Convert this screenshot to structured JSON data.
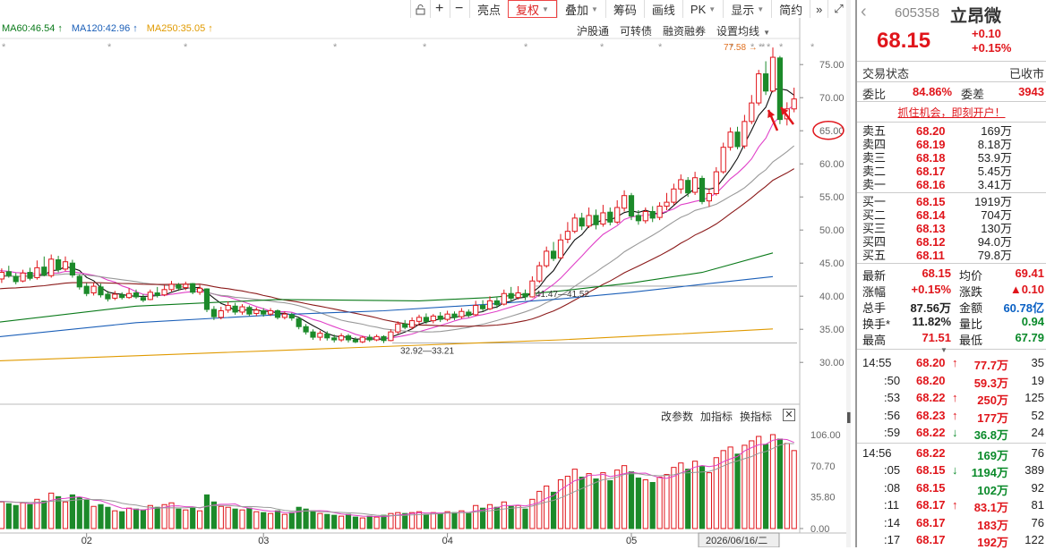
{
  "toolbar": {
    "icons": [
      "lock-icon",
      "plus-icon",
      "minus-icon"
    ],
    "buttons": [
      {
        "label": "亮点",
        "caret": false,
        "active": false
      },
      {
        "label": "复权",
        "caret": true,
        "active": true
      },
      {
        "label": "叠加",
        "caret": true,
        "active": false
      },
      {
        "label": "筹码",
        "caret": false,
        "active": false
      },
      {
        "label": "画线",
        "caret": false,
        "active": false
      },
      {
        "label": "PK",
        "caret": true,
        "active": false
      },
      {
        "label": "显示",
        "caret": true,
        "active": false
      },
      {
        "label": "简约",
        "caret": false,
        "active": false
      }
    ],
    "more_icon": "»",
    "fullscreen_icon": "⤢"
  },
  "ma_legend": [
    {
      "text": "MA60:46.54",
      "arrow": "↑",
      "color": "#0a7a1a"
    },
    {
      "text": "MA120:42.96",
      "arrow": "↑",
      "color": "#1b5fb8"
    },
    {
      "text": "MA250:35.05",
      "arrow": "↑",
      "color": "#e09a00"
    }
  ],
  "top_links": [
    "沪股通",
    "可转债",
    "融资融券",
    "设置均线"
  ],
  "annotations": {
    "high": "77.58 →",
    "range1": "41.47—41.52",
    "range2": "32.92—33.21",
    "circled_price": "65.00",
    "date_cursor": "2026/06/16/二"
  },
  "price_axis": [
    "75.00",
    "70.00",
    "65.00",
    "60.00",
    "55.00",
    "50.00",
    "45.00",
    "40.00",
    "35.00",
    "30.00"
  ],
  "vol_axis": [
    "106.00",
    "70.70",
    "35.80",
    "0.00"
  ],
  "x_axis": [
    "02",
    "03",
    "04",
    "05"
  ],
  "lower_links": [
    "改参数",
    "加指标",
    "换指标"
  ],
  "close_icon": "✕",
  "chart_data": {
    "type": "candlestick",
    "ylim": [
      28,
      78
    ],
    "ma_names": [
      "MA5",
      "MA10",
      "MA20",
      "MA30",
      "MA60",
      "MA120",
      "MA250"
    ],
    "candles": [
      {
        "o": 43.5,
        "c": 42.8,
        "h": 44.1,
        "l": 42.2,
        "v": 34
      },
      {
        "o": 42.6,
        "c": 43.6,
        "h": 44.2,
        "l": 42.0,
        "v": 30
      },
      {
        "o": 43.7,
        "c": 43.1,
        "h": 44.6,
        "l": 42.8,
        "v": 28
      },
      {
        "o": 43.0,
        "c": 42.2,
        "h": 43.5,
        "l": 41.8,
        "v": 26
      },
      {
        "o": 42.3,
        "c": 43.5,
        "h": 44.0,
        "l": 42.1,
        "v": 29
      },
      {
        "o": 43.6,
        "c": 42.7,
        "h": 44.3,
        "l": 42.4,
        "v": 27
      },
      {
        "o": 42.8,
        "c": 44.3,
        "h": 45.4,
        "l": 42.5,
        "v": 33
      },
      {
        "o": 44.4,
        "c": 43.2,
        "h": 46.0,
        "l": 43.0,
        "v": 31
      },
      {
        "o": 43.1,
        "c": 45.6,
        "h": 46.3,
        "l": 42.8,
        "v": 40
      },
      {
        "o": 45.5,
        "c": 44.0,
        "h": 46.1,
        "l": 43.6,
        "v": 36
      },
      {
        "o": 44.1,
        "c": 45.2,
        "h": 46.0,
        "l": 43.8,
        "v": 30
      },
      {
        "o": 45.0,
        "c": 43.2,
        "h": 45.5,
        "l": 42.8,
        "v": 38
      },
      {
        "o": 43.0,
        "c": 41.4,
        "h": 43.3,
        "l": 41.0,
        "v": 35
      },
      {
        "o": 41.5,
        "c": 40.4,
        "h": 42.0,
        "l": 40.0,
        "v": 32
      },
      {
        "o": 40.5,
        "c": 41.5,
        "h": 42.0,
        "l": 40.1,
        "v": 25
      },
      {
        "o": 41.4,
        "c": 40.2,
        "h": 41.9,
        "l": 39.8,
        "v": 27
      },
      {
        "o": 40.3,
        "c": 39.6,
        "h": 40.8,
        "l": 39.2,
        "v": 24
      },
      {
        "o": 39.7,
        "c": 40.3,
        "h": 40.8,
        "l": 39.4,
        "v": 20
      },
      {
        "o": 40.2,
        "c": 39.8,
        "h": 40.6,
        "l": 39.5,
        "v": 19
      },
      {
        "o": 39.8,
        "c": 40.4,
        "h": 41.2,
        "l": 39.6,
        "v": 23
      },
      {
        "o": 40.5,
        "c": 39.9,
        "h": 41.0,
        "l": 39.6,
        "v": 22
      },
      {
        "o": 39.8,
        "c": 39.4,
        "h": 40.3,
        "l": 39.1,
        "v": 21
      },
      {
        "o": 39.5,
        "c": 40.6,
        "h": 41.0,
        "l": 39.4,
        "v": 26
      },
      {
        "o": 40.5,
        "c": 40.1,
        "h": 41.4,
        "l": 39.8,
        "v": 24
      },
      {
        "o": 40.2,
        "c": 41.0,
        "h": 41.7,
        "l": 40.0,
        "v": 27
      },
      {
        "o": 41.0,
        "c": 41.8,
        "h": 42.3,
        "l": 40.7,
        "v": 29
      },
      {
        "o": 41.7,
        "c": 41.2,
        "h": 42.0,
        "l": 40.8,
        "v": 22
      },
      {
        "o": 41.3,
        "c": 41.8,
        "h": 42.2,
        "l": 40.9,
        "v": 21
      },
      {
        "o": 41.9,
        "c": 40.6,
        "h": 42.0,
        "l": 40.3,
        "v": 24
      },
      {
        "o": 40.6,
        "c": 41.2,
        "h": 41.7,
        "l": 40.2,
        "v": 20
      },
      {
        "o": 41.1,
        "c": 38.0,
        "h": 41.2,
        "l": 37.6,
        "v": 38
      },
      {
        "o": 38.0,
        "c": 36.9,
        "h": 38.5,
        "l": 36.4,
        "v": 30
      },
      {
        "o": 36.8,
        "c": 37.8,
        "h": 38.4,
        "l": 36.5,
        "v": 25
      },
      {
        "o": 37.9,
        "c": 38.6,
        "h": 39.2,
        "l": 37.5,
        "v": 24
      },
      {
        "o": 38.5,
        "c": 37.6,
        "h": 39.0,
        "l": 37.2,
        "v": 22
      },
      {
        "o": 37.6,
        "c": 38.4,
        "h": 38.8,
        "l": 37.2,
        "v": 21
      },
      {
        "o": 38.3,
        "c": 37.3,
        "h": 38.6,
        "l": 37.0,
        "v": 23
      },
      {
        "o": 37.4,
        "c": 37.9,
        "h": 38.3,
        "l": 37.0,
        "v": 19
      },
      {
        "o": 37.8,
        "c": 37.3,
        "h": 38.2,
        "l": 36.9,
        "v": 18
      },
      {
        "o": 37.3,
        "c": 37.8,
        "h": 38.2,
        "l": 37.0,
        "v": 17
      },
      {
        "o": 37.8,
        "c": 36.8,
        "h": 38.0,
        "l": 36.5,
        "v": 20
      },
      {
        "o": 36.8,
        "c": 37.3,
        "h": 37.7,
        "l": 36.5,
        "v": 16
      },
      {
        "o": 37.2,
        "c": 36.7,
        "h": 37.5,
        "l": 36.3,
        "v": 18
      },
      {
        "o": 36.6,
        "c": 35.4,
        "h": 36.8,
        "l": 35.0,
        "v": 24
      },
      {
        "o": 35.4,
        "c": 34.6,
        "h": 35.8,
        "l": 34.2,
        "v": 22
      },
      {
        "o": 34.6,
        "c": 33.8,
        "h": 35.0,
        "l": 33.4,
        "v": 20
      },
      {
        "o": 33.8,
        "c": 34.4,
        "h": 34.8,
        "l": 33.3,
        "v": 17
      },
      {
        "o": 34.3,
        "c": 33.7,
        "h": 34.7,
        "l": 33.3,
        "v": 16
      },
      {
        "o": 33.7,
        "c": 33.4,
        "h": 34.2,
        "l": 33.0,
        "v": 15
      },
      {
        "o": 33.4,
        "c": 34.0,
        "h": 34.4,
        "l": 33.1,
        "v": 14
      },
      {
        "o": 34.0,
        "c": 33.4,
        "h": 34.3,
        "l": 33.0,
        "v": 16
      },
      {
        "o": 33.4,
        "c": 33.1,
        "h": 33.8,
        "l": 32.9,
        "v": 13
      },
      {
        "o": 33.1,
        "c": 33.8,
        "h": 34.0,
        "l": 32.9,
        "v": 12
      },
      {
        "o": 33.8,
        "c": 33.4,
        "h": 34.2,
        "l": 33.1,
        "v": 14
      },
      {
        "o": 33.4,
        "c": 33.9,
        "h": 34.2,
        "l": 33.2,
        "v": 13
      },
      {
        "o": 33.9,
        "c": 33.3,
        "h": 34.1,
        "l": 32.92,
        "v": 15
      },
      {
        "o": 33.3,
        "c": 34.6,
        "h": 35.0,
        "l": 33.2,
        "v": 17
      },
      {
        "o": 34.6,
        "c": 35.8,
        "h": 36.2,
        "l": 34.3,
        "v": 18
      },
      {
        "o": 35.8,
        "c": 35.3,
        "h": 36.4,
        "l": 35.0,
        "v": 17
      },
      {
        "o": 35.3,
        "c": 36.3,
        "h": 36.8,
        "l": 35.0,
        "v": 18
      },
      {
        "o": 36.2,
        "c": 36.8,
        "h": 37.2,
        "l": 35.8,
        "v": 19
      },
      {
        "o": 36.8,
        "c": 36.2,
        "h": 37.4,
        "l": 35.8,
        "v": 16
      },
      {
        "o": 36.3,
        "c": 37.0,
        "h": 37.3,
        "l": 35.9,
        "v": 18
      },
      {
        "o": 37.0,
        "c": 36.5,
        "h": 37.6,
        "l": 36.1,
        "v": 17
      },
      {
        "o": 36.5,
        "c": 37.3,
        "h": 37.8,
        "l": 36.2,
        "v": 19
      },
      {
        "o": 37.3,
        "c": 36.8,
        "h": 37.7,
        "l": 36.4,
        "v": 18
      },
      {
        "o": 36.9,
        "c": 37.7,
        "h": 38.2,
        "l": 36.6,
        "v": 20
      },
      {
        "o": 37.6,
        "c": 37.1,
        "h": 38.0,
        "l": 36.8,
        "v": 17
      },
      {
        "o": 37.2,
        "c": 38.6,
        "h": 39.3,
        "l": 37.0,
        "v": 26
      },
      {
        "o": 38.6,
        "c": 38.1,
        "h": 39.4,
        "l": 37.7,
        "v": 23
      },
      {
        "o": 38.1,
        "c": 39.3,
        "h": 40.0,
        "l": 37.9,
        "v": 27
      },
      {
        "o": 39.3,
        "c": 38.7,
        "h": 39.8,
        "l": 38.2,
        "v": 24
      },
      {
        "o": 38.8,
        "c": 40.4,
        "h": 41.0,
        "l": 38.6,
        "v": 30
      },
      {
        "o": 40.4,
        "c": 39.7,
        "h": 41.4,
        "l": 39.2,
        "v": 25
      },
      {
        "o": 39.8,
        "c": 40.5,
        "h": 41.52,
        "l": 39.5,
        "v": 26
      },
      {
        "o": 40.4,
        "c": 39.9,
        "h": 41.0,
        "l": 39.4,
        "v": 22
      },
      {
        "o": 39.9,
        "c": 42.3,
        "h": 43.0,
        "l": 39.8,
        "v": 33
      },
      {
        "o": 42.3,
        "c": 44.6,
        "h": 45.2,
        "l": 42.0,
        "v": 42
      },
      {
        "o": 44.6,
        "c": 46.8,
        "h": 47.5,
        "l": 44.3,
        "v": 48
      },
      {
        "o": 46.8,
        "c": 45.7,
        "h": 48.2,
        "l": 45.3,
        "v": 41
      },
      {
        "o": 45.8,
        "c": 48.5,
        "h": 49.4,
        "l": 45.6,
        "v": 55
      },
      {
        "o": 48.6,
        "c": 49.8,
        "h": 51.2,
        "l": 48.0,
        "v": 59
      },
      {
        "o": 49.8,
        "c": 51.8,
        "h": 52.5,
        "l": 49.5,
        "v": 67
      },
      {
        "o": 51.8,
        "c": 50.6,
        "h": 52.6,
        "l": 50.0,
        "v": 58
      },
      {
        "o": 50.6,
        "c": 52.2,
        "h": 53.4,
        "l": 50.3,
        "v": 62
      },
      {
        "o": 52.2,
        "c": 50.8,
        "h": 53.1,
        "l": 50.1,
        "v": 56
      },
      {
        "o": 50.9,
        "c": 52.6,
        "h": 53.8,
        "l": 50.5,
        "v": 63
      },
      {
        "o": 52.7,
        "c": 51.2,
        "h": 53.4,
        "l": 50.7,
        "v": 54
      },
      {
        "o": 51.2,
        "c": 53.4,
        "h": 54.5,
        "l": 50.9,
        "v": 66
      },
      {
        "o": 53.3,
        "c": 55.2,
        "h": 56.0,
        "l": 52.8,
        "v": 71
      },
      {
        "o": 55.2,
        "c": 52.1,
        "h": 55.6,
        "l": 51.5,
        "v": 64
      },
      {
        "o": 52.2,
        "c": 51.4,
        "h": 53.0,
        "l": 50.8,
        "v": 57
      },
      {
        "o": 51.4,
        "c": 52.8,
        "h": 53.4,
        "l": 51.0,
        "v": 55
      },
      {
        "o": 52.8,
        "c": 51.8,
        "h": 53.6,
        "l": 51.2,
        "v": 52
      },
      {
        "o": 51.9,
        "c": 53.6,
        "h": 54.2,
        "l": 51.5,
        "v": 58
      },
      {
        "o": 53.6,
        "c": 54.2,
        "h": 55.6,
        "l": 53.0,
        "v": 61
      },
      {
        "o": 54.2,
        "c": 56.2,
        "h": 57.0,
        "l": 53.8,
        "v": 69
      },
      {
        "o": 56.2,
        "c": 57.6,
        "h": 58.4,
        "l": 55.5,
        "v": 74
      },
      {
        "o": 57.5,
        "c": 55.6,
        "h": 58.0,
        "l": 55.0,
        "v": 67
      },
      {
        "o": 55.7,
        "c": 57.9,
        "h": 58.8,
        "l": 55.3,
        "v": 76
      },
      {
        "o": 57.8,
        "c": 54.3,
        "h": 58.2,
        "l": 53.9,
        "v": 70
      },
      {
        "o": 54.4,
        "c": 55.5,
        "h": 56.3,
        "l": 53.5,
        "v": 63
      },
      {
        "o": 55.5,
        "c": 58.8,
        "h": 59.5,
        "l": 55.2,
        "v": 80
      },
      {
        "o": 58.8,
        "c": 62.5,
        "h": 63.2,
        "l": 58.5,
        "v": 88
      },
      {
        "o": 62.5,
        "c": 64.8,
        "h": 65.5,
        "l": 62.0,
        "v": 92
      },
      {
        "o": 64.8,
        "c": 62.6,
        "h": 65.6,
        "l": 62.2,
        "v": 84
      },
      {
        "o": 62.7,
        "c": 66.4,
        "h": 67.4,
        "l": 62.3,
        "v": 94
      },
      {
        "o": 66.4,
        "c": 69.2,
        "h": 70.4,
        "l": 66.0,
        "v": 99
      },
      {
        "o": 69.2,
        "c": 73.6,
        "h": 74.2,
        "l": 68.8,
        "v": 104
      },
      {
        "o": 73.6,
        "c": 71.0,
        "h": 75.5,
        "l": 70.4,
        "v": 95
      },
      {
        "o": 71.0,
        "c": 76.1,
        "h": 77.58,
        "l": 70.8,
        "v": 106
      },
      {
        "o": 76.0,
        "c": 66.7,
        "h": 76.3,
        "l": 66.0,
        "v": 101
      },
      {
        "o": 66.8,
        "c": 68.3,
        "h": 69.3,
        "l": 65.8,
        "v": 96
      },
      {
        "o": 68.3,
        "c": 69.8,
        "h": 71.51,
        "l": 67.79,
        "v": 88
      }
    ],
    "volume_ylim": [
      0,
      106
    ]
  },
  "stock": {
    "code": "605358",
    "name": "立昂微",
    "price": "68.15",
    "change": "+0.10",
    "change_pct": "+0.15%",
    "status_label": "交易状态",
    "status_value": "已收市",
    "weibi_label": "委比",
    "weibi_value": "84.86%",
    "weicha_label": "委差",
    "weicha_value": "3943",
    "promo": "抓住机会，即刻开户！",
    "asks": [
      {
        "label": "卖五",
        "price": "68.20",
        "vol": "169万"
      },
      {
        "label": "卖四",
        "price": "68.19",
        "vol": "8.18万"
      },
      {
        "label": "卖三",
        "price": "68.18",
        "vol": "53.9万"
      },
      {
        "label": "卖二",
        "price": "68.17",
        "vol": "5.45万"
      },
      {
        "label": "卖一",
        "price": "68.16",
        "vol": "3.41万"
      }
    ],
    "bids": [
      {
        "label": "买一",
        "price": "68.15",
        "vol": "1919万"
      },
      {
        "label": "买二",
        "price": "68.14",
        "vol": "704万"
      },
      {
        "label": "买三",
        "price": "68.13",
        "vol": "130万"
      },
      {
        "label": "买四",
        "price": "68.12",
        "vol": "94.0万"
      },
      {
        "label": "买五",
        "price": "68.11",
        "vol": "79.8万"
      }
    ],
    "stats": [
      {
        "l1": "最新",
        "v1": "68.15",
        "c1": "red",
        "l2": "均价",
        "v2": "69.41",
        "c2": "red"
      },
      {
        "l1": "涨幅",
        "v1": "+0.15%",
        "c1": "red",
        "l2": "涨跌",
        "v2": "▲0.10",
        "c2": "red"
      },
      {
        "l1": "总手",
        "v1": "87.56万",
        "c1": "blk",
        "l2": "金额",
        "v2": "60.78亿",
        "c2": "blue"
      },
      {
        "l1": "换手*",
        "v1": "11.82%",
        "c1": "blk",
        "l2": "量比",
        "v2": "0.94",
        "c2": "grn"
      },
      {
        "l1": "最高",
        "v1": "71.51",
        "c1": "red",
        "l2": "最低",
        "v2": "67.79",
        "c2": "grn"
      }
    ],
    "ticks": [
      {
        "t": "14:55",
        "p": "68.20",
        "pc": "red",
        "a": "↑",
        "ac": "red",
        "v": "77.7万",
        "vc": "red",
        "n": "35"
      },
      {
        "t": ":50",
        "p": "68.20",
        "pc": "red",
        "a": "",
        "ac": "red",
        "v": "59.3万",
        "vc": "red",
        "n": "19"
      },
      {
        "t": ":53",
        "p": "68.22",
        "pc": "red",
        "a": "↑",
        "ac": "red",
        "v": "250万",
        "vc": "red",
        "n": "125"
      },
      {
        "t": ":56",
        "p": "68.23",
        "pc": "red",
        "a": "↑",
        "ac": "red",
        "v": "177万",
        "vc": "red",
        "n": "52"
      },
      {
        "t": ":59",
        "p": "68.22",
        "pc": "red",
        "a": "↓",
        "ac": "grn",
        "v": "36.8万",
        "vc": "grn",
        "n": "24"
      },
      {
        "t": "14:56",
        "p": "68.22",
        "pc": "red",
        "a": "",
        "ac": "red",
        "v": "169万",
        "vc": "grn",
        "n": "76"
      },
      {
        "t": ":05",
        "p": "68.15",
        "pc": "red",
        "a": "↓",
        "ac": "grn",
        "v": "1194万",
        "vc": "grn",
        "n": "389"
      },
      {
        "t": ":08",
        "p": "68.15",
        "pc": "red",
        "a": "",
        "ac": "red",
        "v": "102万",
        "vc": "grn",
        "n": "92"
      },
      {
        "t": ":11",
        "p": "68.17",
        "pc": "red",
        "a": "↑",
        "ac": "red",
        "v": "83.1万",
        "vc": "red",
        "n": "81"
      },
      {
        "t": ":14",
        "p": "68.17",
        "pc": "red",
        "a": "",
        "ac": "red",
        "v": "183万",
        "vc": "red",
        "n": "76"
      },
      {
        "t": ":17",
        "p": "68.17",
        "pc": "red",
        "a": "",
        "ac": "red",
        "v": "192万",
        "vc": "red",
        "n": "122"
      }
    ]
  }
}
